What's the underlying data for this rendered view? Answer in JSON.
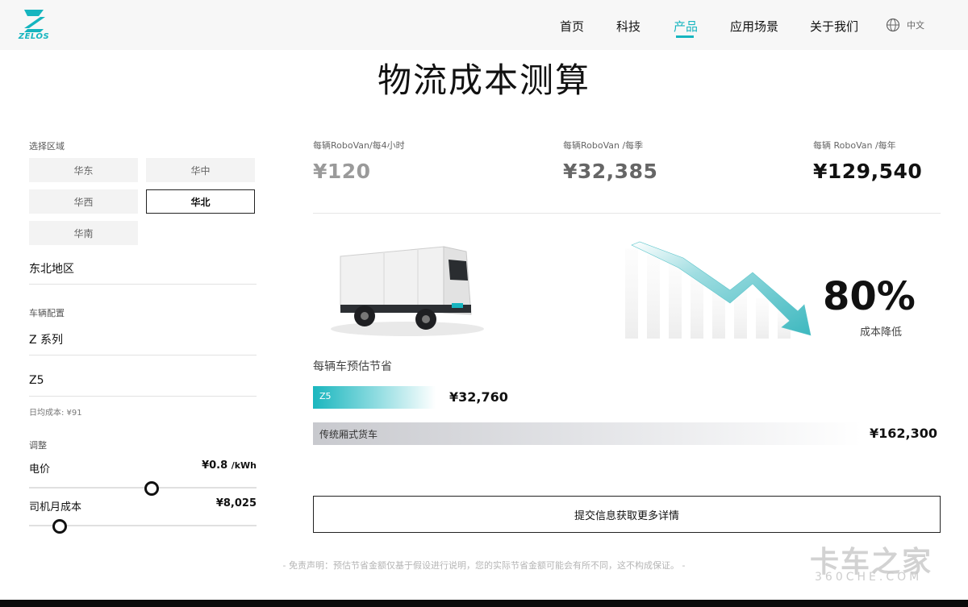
{
  "header": {
    "logo_text": "ZELOS",
    "nav": [
      {
        "label": "首页",
        "active": false
      },
      {
        "label": "科技",
        "active": false
      },
      {
        "label": "产品",
        "active": true
      },
      {
        "label": "应用场景",
        "active": false
      },
      {
        "label": "关于我们",
        "active": false
      }
    ],
    "language": "中文",
    "accent_color": "#16b5bf"
  },
  "page_title": "物流成本测算",
  "left": {
    "region_label": "选择区域",
    "regions": [
      "华东",
      "华中",
      "华西",
      "华北",
      "华南"
    ],
    "selected_region": "华北",
    "subregion": "东北地区",
    "vehicle_label": "车辆配置",
    "series": "Z 系列",
    "model": "Z5",
    "daily_cost": "日均成本: ¥91",
    "adjust_label": "调整",
    "electricity": {
      "label": "电价",
      "value": "¥0.8",
      "unit": "/kWh",
      "slider_fraction": 0.5
    },
    "driver": {
      "label": "司机月成本",
      "value": "¥8,025",
      "slider_fraction": 0.13
    }
  },
  "metrics": [
    {
      "label": "每辆RoboVan/每4小时",
      "value": "¥120",
      "color": "#9a9a9a"
    },
    {
      "label": "每辆RoboVan /每季",
      "value": "¥32,385",
      "color": "#666666"
    },
    {
      "label": "每辆 RoboVan /每年",
      "value": "¥129,540",
      "color": "#111111"
    }
  ],
  "reduction": {
    "value": "80%",
    "label": "成本降低"
  },
  "savings": {
    "label": "每辆车预估节省",
    "z5_label": "Z5",
    "z5_value": "¥32,760",
    "truck_label": "传统厢式货车",
    "truck_value": "¥162,300"
  },
  "submit_label": "提交信息获取更多详情",
  "disclaimer": "- 免责声明：预估节省金额仅基于假设进行说明，您的实际节省金额可能会有所不同，这不构成保证。 -",
  "watermark": {
    "main": "卡车之家",
    "sub": "360CHE.COM"
  }
}
